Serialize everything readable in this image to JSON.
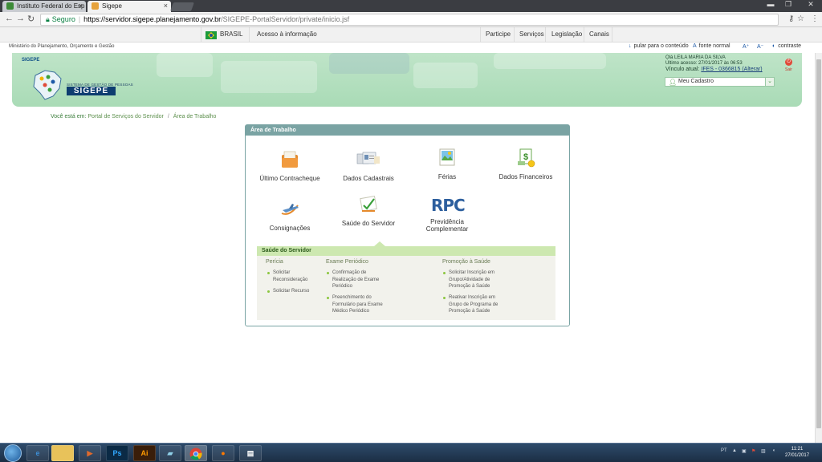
{
  "browser": {
    "tabs": [
      {
        "title": "Instituto Federal do Esp",
        "close": "×"
      },
      {
        "title": "Sigepe",
        "close": "×"
      }
    ],
    "address": {
      "secure_label": "Seguro",
      "host": "https://servidor.sigepe.planejamento.gov.br",
      "path": "/SIGEPE-PortalServidor/private/inicio.jsf"
    }
  },
  "govbar": {
    "country": "BRASIL",
    "access": "Acesso à informação",
    "links": [
      "Participe",
      "Serviços",
      "Legislação",
      "Canais"
    ]
  },
  "ministry": "Ministério do Planejamento, Orçamento e Gestão",
  "accessibility": {
    "skip": "pular para o conteúdo",
    "font": "fonte normal",
    "font_up": "A⁺",
    "font_down": "A⁻",
    "contrast": "contraste"
  },
  "header": {
    "logo_small": "SIGEPE",
    "logo_subtitle": "SISTEMA DE GESTÃO DE PESSOAS",
    "logo_name": "SIGEPE",
    "greeting": "Olá LEILA MARIA DA SILVA",
    "last_access": "Último acesso: 27/01/2017 às 06:53",
    "vinculo_label": "Vínculo atual:",
    "vinculo_value": "IFES - 0366815 (Alterar)",
    "profile_select": "Meu Cadastro",
    "logout": "Sair"
  },
  "breadcrumb": {
    "label": "Você está em:",
    "items": [
      "Portal de Serviços do Servidor",
      "Área de Trabalho"
    ],
    "separator": "/"
  },
  "workarea": {
    "title": "Área de Trabalho",
    "tiles": [
      {
        "label": "Último Contracheque",
        "icon": "paycheck-folder-icon"
      },
      {
        "label": "Dados Cadastrais",
        "icon": "id-cards-icon"
      },
      {
        "label": "Férias",
        "icon": "vacation-photo-icon"
      },
      {
        "label": "Dados Financeiros",
        "icon": "money-icon"
      },
      {
        "label": "Consignações",
        "icon": "airplane-icon"
      },
      {
        "label": "Saúde do Servidor",
        "icon": "health-check-icon"
      },
      {
        "label": "Previdência Complementar",
        "icon": "rpc-icon"
      }
    ],
    "rpc_text": "RPC"
  },
  "health": {
    "title": "Saúde do Servidor",
    "columns": [
      {
        "title": "Perícia",
        "items": [
          "Solicitar Reconsideração",
          "Solicitar Recurso"
        ]
      },
      {
        "title": "Exame Periódico",
        "items": [
          "Confirmação de Realização de Exame Periódico",
          "Preenchimento do Formulário para Exame Médico Periódico"
        ]
      },
      {
        "title": "Promoção à Saúde",
        "items": [
          "Solicitar Inscrição em Grupo/Atividade de Promoção à Saúde",
          "Reativar Inscrição em Grupo de Programa de Promoção à Saúde"
        ]
      }
    ]
  },
  "taskbar": {
    "apps": [
      "Ps",
      "Ai"
    ],
    "lang": "PT",
    "time": "11:21",
    "date": "27/01/2017"
  },
  "colors": {
    "header_green": "#a9dbb6",
    "panel_teal": "#7aa3a3",
    "sub_head_green": "#cde8b0",
    "breadcrumb_green": "#3a7d3a"
  }
}
